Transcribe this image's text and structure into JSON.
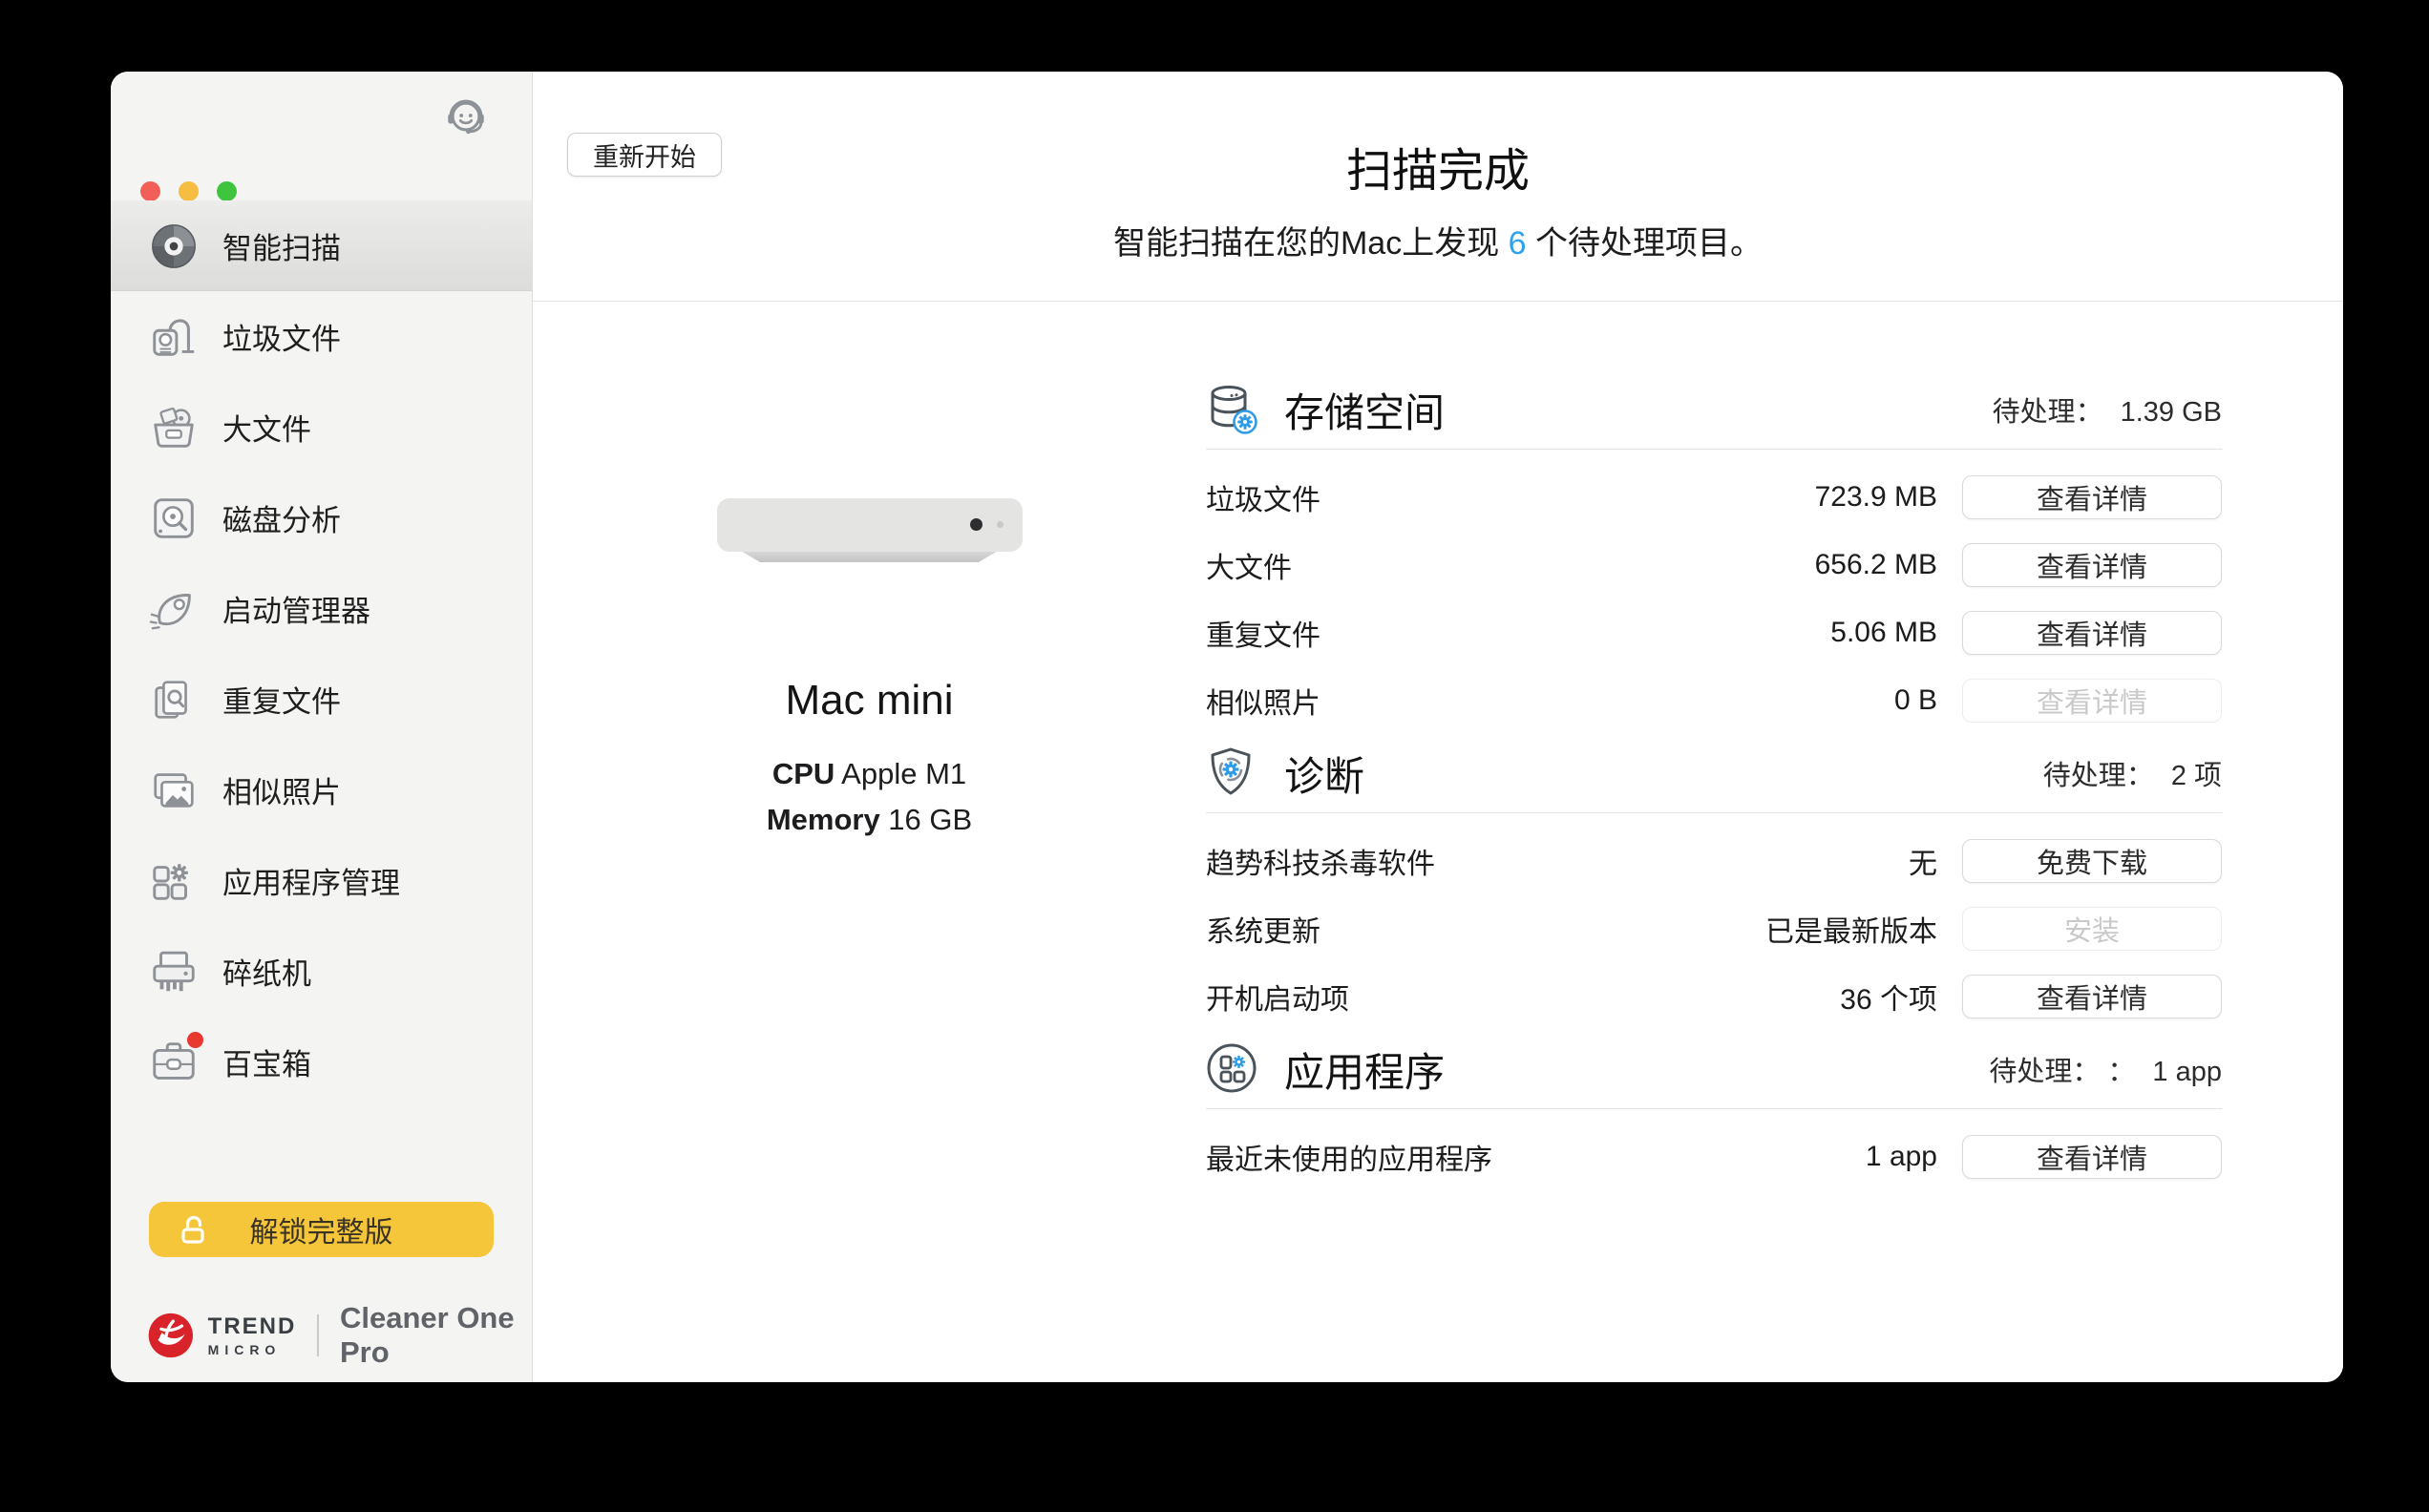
{
  "sidebar": {
    "items": [
      {
        "label": "智能扫描",
        "icon": "smart-scan-icon",
        "selected": true
      },
      {
        "label": "垃圾文件",
        "icon": "junk-files-icon"
      },
      {
        "label": "大文件",
        "icon": "big-files-icon"
      },
      {
        "label": "磁盘分析",
        "icon": "disk-analysis-icon"
      },
      {
        "label": "启动管理器",
        "icon": "startup-manager-icon"
      },
      {
        "label": "重复文件",
        "icon": "duplicate-files-icon"
      },
      {
        "label": "相似照片",
        "icon": "similar-photos-icon"
      },
      {
        "label": "应用程序管理",
        "icon": "app-manager-icon"
      },
      {
        "label": "碎纸机",
        "icon": "shredder-icon"
      },
      {
        "label": "百宝箱",
        "icon": "toolbox-icon",
        "badge": true
      }
    ],
    "unlock_button": "解锁完整版",
    "brand": {
      "trend": "TREND",
      "micro": "MICRO",
      "product": "Cleaner One Pro"
    }
  },
  "header": {
    "restart_button": "重新开始",
    "title": "扫描完成",
    "subtitle_prefix": "智能扫描在您的Mac上发现 ",
    "subtitle_count": "6",
    "subtitle_suffix": " 个待处理项目。"
  },
  "device": {
    "name": "Mac mini",
    "cpu_label": "CPU",
    "cpu_value": " Apple M1",
    "memory_label": "Memory",
    "memory_value": " 16 GB"
  },
  "sections": [
    {
      "title": "存储空间",
      "icon": "storage-icon",
      "pending_label": "待处理：",
      "pending_value": "1.39 GB",
      "rows": [
        {
          "label": "垃圾文件",
          "value": "723.9 MB",
          "action": "查看详情",
          "disabled": false
        },
        {
          "label": "大文件",
          "value": "656.2 MB",
          "action": "查看详情",
          "disabled": false
        },
        {
          "label": "重复文件",
          "value": "5.06 MB",
          "action": "查看详情",
          "disabled": false
        },
        {
          "label": "相似照片",
          "value": "0 B",
          "action": "查看详情",
          "disabled": true
        }
      ]
    },
    {
      "title": "诊断",
      "icon": "diagnostics-icon",
      "pending_label": "待处理：",
      "pending_value": "2 项",
      "rows": [
        {
          "label": "趋势科技杀毒软件",
          "value": "无",
          "action": "免费下载",
          "disabled": false
        },
        {
          "label": "系统更新",
          "value": "已是最新版本",
          "action": "安装",
          "disabled": true
        },
        {
          "label": "开机启动项",
          "value": "36 个项",
          "action": "查看详情",
          "disabled": false
        }
      ]
    },
    {
      "title": "应用程序",
      "icon": "applications-icon",
      "pending_label": "待处理： ：",
      "pending_value": "1 app",
      "rows": [
        {
          "label": "最近未使用的应用程序",
          "value": "1 app",
          "action": "查看详情",
          "disabled": false
        }
      ]
    }
  ],
  "colors": {
    "accent_blue": "#2fa3ea",
    "unlock_yellow": "#f5c53a",
    "brand_red": "#d8232a",
    "badge_red": "#e8382f",
    "sidebar_bg": "#f4f4f2"
  }
}
